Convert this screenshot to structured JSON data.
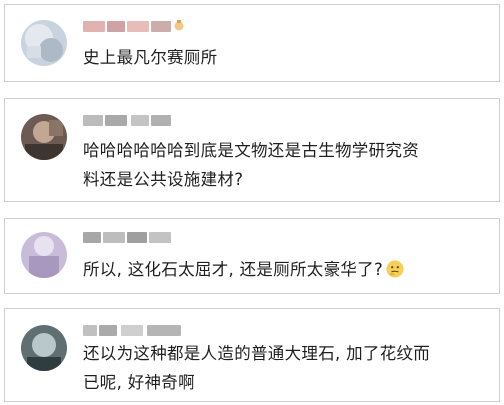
{
  "comments": [
    {
      "text_lines": [
        "史上最凡尔赛厕所"
      ],
      "avatar_colors": [
        "#c9d3df",
        "#aeb9c6",
        "#e5e8ee"
      ],
      "name_colors": [
        "#d9a7a7",
        "#c9a3a8",
        "#e6b9b5",
        "#c8aaa8"
      ],
      "icon": "emoji-icon"
    },
    {
      "text_lines": [
        "哈哈哈哈哈哈到底是文物还是古生物学研究资",
        "料还是公共设施建材?"
      ],
      "avatar_colors": [
        "#6d5a52",
        "#c3a795",
        "#3e3530"
      ],
      "name_colors": [
        "#bcbcbc",
        "#a9a9a9",
        "#c4c4c4",
        "#b0b0b0"
      ]
    },
    {
      "text_lines": [
        "所以, 这化石太屈才, 还是厕所太豪华了?"
      ],
      "avatar_colors": [
        "#c9bcd9",
        "#a898c0",
        "#e8e2f0"
      ],
      "name_colors": [
        "#a7a7a7",
        "#bdbdbd",
        "#9f9f9f",
        "#c3c3c3"
      ],
      "emoji": "thinking-emoji-icon"
    },
    {
      "text_lines": [
        "还以为这种都是人造的普通大理石, 加了花纹而",
        "已呢, 好神奇啊"
      ],
      "avatar_colors": [
        "#5f6f72",
        "#b9c8cb",
        "#2f3c40"
      ],
      "name_colors": [
        "#c0c0c0",
        "#aaaaaa",
        "#cfcfcf",
        "#b5b5b5"
      ]
    }
  ]
}
